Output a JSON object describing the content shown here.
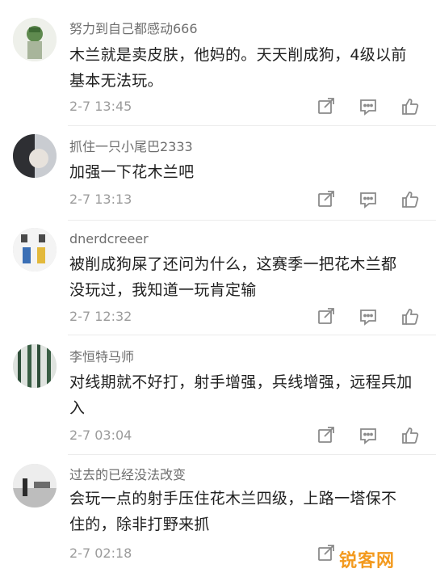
{
  "comments": [
    {
      "username": "努力到自己都感动666",
      "text_lines": [
        "木兰就是卖皮肤，他妈的。天天削成狗，4级以前",
        "基本无法玩。"
      ],
      "time": "2-7 13:45"
    },
    {
      "username": "抓住一只小尾巴2333",
      "text_lines": [
        "加强一下花木兰吧"
      ],
      "time": "2-7 13:13"
    },
    {
      "username": "dnerdcreeer",
      "text_lines": [
        "被削成狗屎了还问为什么，这赛季一把花木兰都",
        "没玩过，我知道一玩肯定输"
      ],
      "time": "2-7 12:32"
    },
    {
      "username": "李恒特马师",
      "text_lines": [
        "对线期就不好打，射手增强，兵线增强，远程兵加",
        "入"
      ],
      "time": "2-7 03:04"
    },
    {
      "username": "过去的已经没法改变",
      "text_lines": [
        "会玩一点的射手压住花木兰四级，上路一塔保不",
        "住的，除非打野来抓"
      ],
      "time": "2-7 02:18"
    }
  ],
  "icons": {
    "share": "share-icon",
    "reply": "comment-icon",
    "like": "thumbs-up-icon"
  },
  "watermark": {
    "text": "锐客网"
  },
  "colors": {
    "text": "#1f1f1f",
    "meta": "#9b9b9b",
    "icon": "#8a8a8a",
    "watermark": "#f39a1e"
  }
}
